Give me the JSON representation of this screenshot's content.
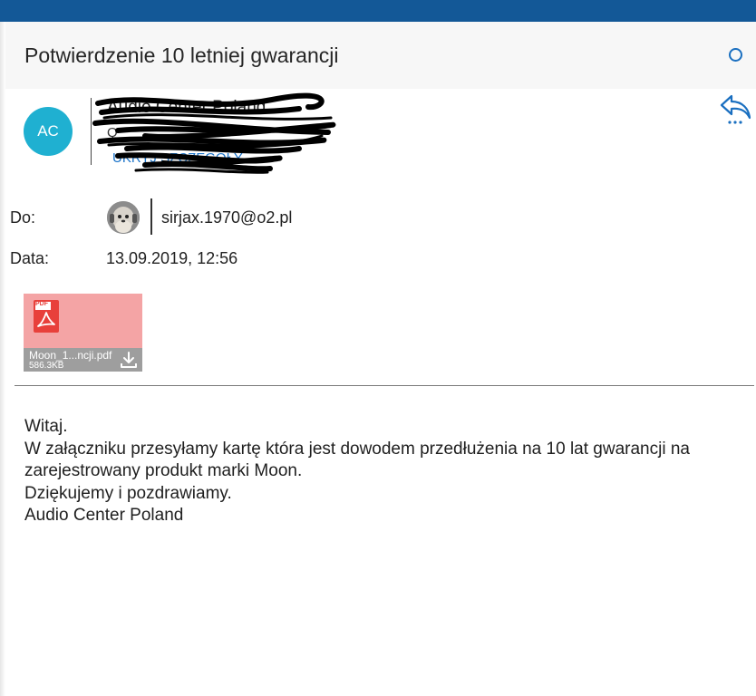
{
  "message": {
    "subject": "Potwierdzenie 10 letniej gwarancji"
  },
  "sender": {
    "initials": "AC",
    "name": "Audio Center Poland",
    "email": "Q",
    "details_link": "UKRYJ SZCZEGÓŁY"
  },
  "recipients": {
    "label": "Do:",
    "email": "sirjax.1970@o2.pl"
  },
  "date": {
    "label": "Data:",
    "value": "13.09.2019, 12:56"
  },
  "attachment": {
    "icon_label": "PDF",
    "filename": "Moon_1...ncji.pdf",
    "size": "586.3KB"
  },
  "body": {
    "lines": [
      "Witaj.",
      "W załączniku przesyłamy kartę która jest dowodem przedłużenia na 10 lat gwarancji na",
      "zarejestrowany produkt marki Moon.",
      "Dziękujemy i pozdrawiamy.",
      "Audio Center Poland"
    ]
  },
  "colors": {
    "topbar": "#135897",
    "avatar": "#1fb0d1",
    "link": "#1a73c9",
    "attachment_bg": "#f4a4a5",
    "pdf_red": "#e8403b"
  },
  "icons": {
    "reply": "reply-icon",
    "unread": "unread-indicator-icon",
    "download": "download-icon",
    "pdf": "pdf-file-icon"
  }
}
